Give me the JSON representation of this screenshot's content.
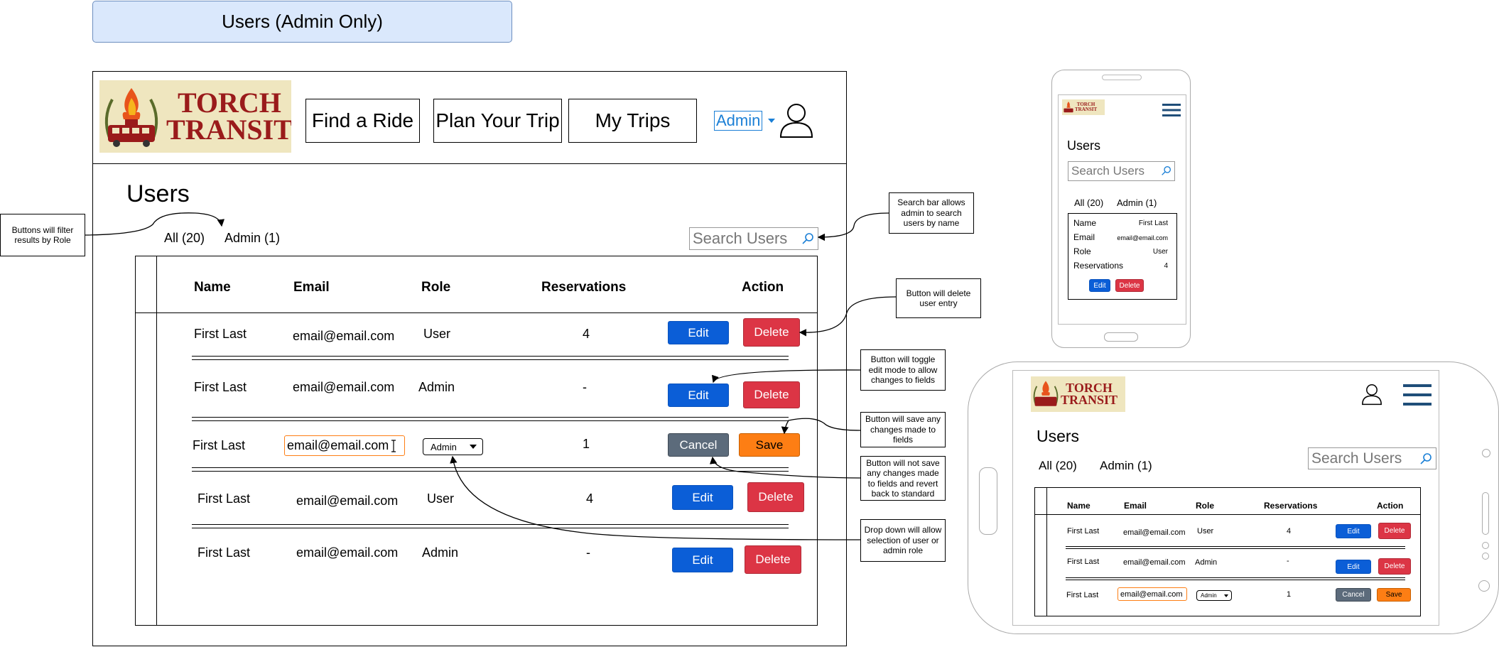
{
  "page_title": "Users (Admin Only)",
  "header": {
    "logo_line1": "TORCH",
    "logo_line2": "TRANSIT",
    "nav": [
      "Find a Ride",
      "Plan Your Trip",
      "My Trips"
    ],
    "admin_label": "Admin"
  },
  "main": {
    "heading": "Users",
    "filters": [
      "All (20)",
      "Admin (1)"
    ],
    "search_placeholder": "Search Users",
    "columns": [
      "Name",
      "Email",
      "Role",
      "Reservations",
      "Action"
    ],
    "rows": [
      {
        "name": "First Last",
        "email": "email@email.com",
        "role": "User",
        "reservations": "4",
        "mode": "view"
      },
      {
        "name": "First Last",
        "email": "email@email.com",
        "role": "Admin",
        "reservations": "-",
        "mode": "view"
      },
      {
        "name": "First Last",
        "email": "email@email.com",
        "role": "Admin",
        "reservations": "1",
        "mode": "edit"
      },
      {
        "name": "First Last",
        "email": "email@email.com",
        "role": "User",
        "reservations": "4",
        "mode": "view"
      },
      {
        "name": "First Last",
        "email": "email@email.com",
        "role": "Admin",
        "reservations": "-",
        "mode": "view"
      }
    ],
    "buttons": {
      "edit": "Edit",
      "delete": "Delete",
      "cancel": "Cancel",
      "save": "Save"
    }
  },
  "annotations": {
    "filter_note": "Buttons will filter results by Role",
    "search_note": "Search bar allows admin to search users by name",
    "delete_note": "Button will delete user entry",
    "edit_note": "Button will toggle edit mode to allow changes to fields",
    "save_note": "Button will save any changes made to fields",
    "cancel_note": "Button will not save any changes made to fields and revert back to standard",
    "dropdown_note": "Drop down will allow selection of user or admin role"
  },
  "mobile": {
    "heading": "Users",
    "search_placeholder": "Search Users",
    "filters": [
      "All (20)",
      "Admin (1)"
    ],
    "card": [
      {
        "label": "Name",
        "value": "First Last"
      },
      {
        "label": "Email",
        "value": "email@email.com"
      },
      {
        "label": "Role",
        "value": "User"
      },
      {
        "label": "Reservations",
        "value": "4"
      }
    ],
    "edit": "Edit",
    "delete": "Delete"
  },
  "tablet": {
    "heading": "Users",
    "search_placeholder": "Search Users",
    "filters": [
      "All (20)",
      "Admin (1)"
    ],
    "columns": [
      "Name",
      "Email",
      "Role",
      "Reservations",
      "Action"
    ],
    "rows": [
      {
        "name": "First Last",
        "email": "email@email.com",
        "role": "User",
        "reservations": "4"
      },
      {
        "name": "First Last",
        "email": "email@email.com",
        "role": "Admin",
        "reservations": "-"
      },
      {
        "name": "First Last",
        "email": "email@email.com",
        "role": "Admin",
        "reservations": "1"
      }
    ],
    "edit": "Edit",
    "delete": "Delete",
    "cancel": "Cancel",
    "save": "Save"
  },
  "colors": {
    "edit": "#0b5ed7",
    "delete": "#dc3545",
    "cancel": "#5c6b7b",
    "save": "#fd7e14",
    "title_bg": "#dae8fc",
    "link": "#1a7fd6"
  },
  "icons": [
    "user-icon",
    "search-icon",
    "hamburger-icon",
    "torch-emblem-icon",
    "dropdown-caret-icon",
    "text-cursor-icon"
  ]
}
